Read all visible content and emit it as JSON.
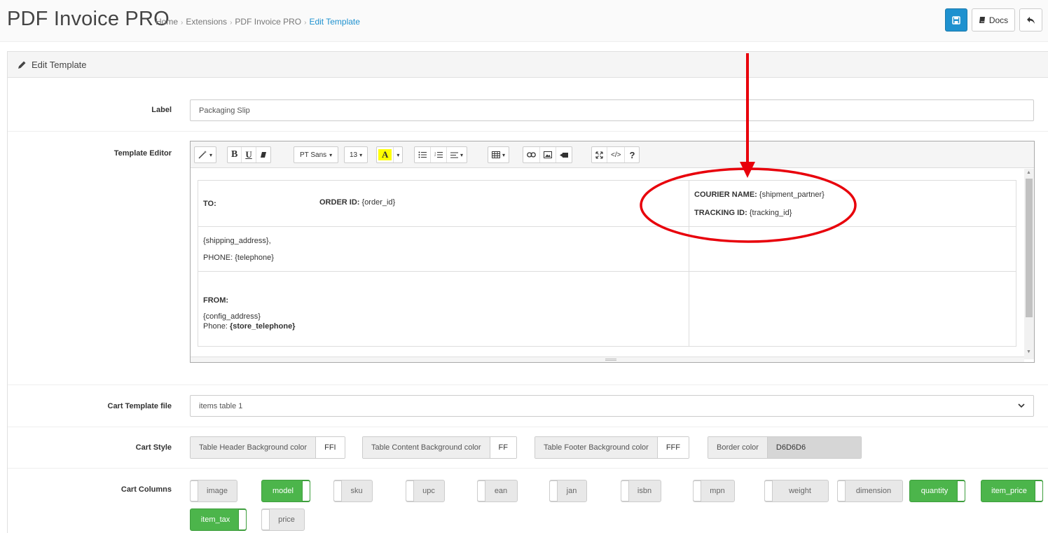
{
  "header": {
    "title": "PDF Invoice PRO",
    "breadcrumb": [
      "Home",
      "Extensions",
      "PDF Invoice PRO",
      "Edit Template"
    ],
    "docs_label": "Docs",
    "accent_color": "#1e91cf"
  },
  "panel": {
    "heading": "Edit Template"
  },
  "form": {
    "label": {
      "label": "Label",
      "value": "Packaging Slip"
    },
    "template_editor": {
      "label": "Template Editor",
      "toolbar": {
        "font_name": "PT Sans",
        "font_size": "13"
      },
      "content": {
        "to": "TO:",
        "order_id_label": "ORDER ID:",
        "order_id_value": "{order_id}",
        "courier_label": "COURIER NAME:",
        "courier_value": "{shipment_partner}",
        "tracking_label": "TRACKING ID:",
        "tracking_value": "{tracking_id}",
        "shipping_address": "{shipping_address},",
        "phone_label": "PHONE:",
        "phone_value": "{telephone}",
        "from": "FROM:",
        "config_address": "{config_address}",
        "store_phone_label": "Phone:",
        "store_phone_value": "{store_telephone}"
      }
    },
    "cart_template": {
      "label": "Cart Template file",
      "value": "items table 1"
    },
    "cart_style": {
      "label": "Cart Style",
      "items": [
        {
          "label": "Table Header Background color",
          "value": "FFI"
        },
        {
          "label": "Table Content Background color",
          "value": "FF"
        },
        {
          "label": "Table Footer Background color",
          "value": "FFF"
        },
        {
          "label": "Border color",
          "value": "D6D6D6"
        }
      ]
    },
    "cart_columns": {
      "label": "Cart Columns",
      "items": [
        {
          "label": "image",
          "on": false
        },
        {
          "label": "model",
          "on": true
        },
        {
          "label": "sku",
          "on": false
        },
        {
          "label": "upc",
          "on": false
        },
        {
          "label": "ean",
          "on": false
        },
        {
          "label": "jan",
          "on": false
        },
        {
          "label": "isbn",
          "on": false
        },
        {
          "label": "mpn",
          "on": false
        },
        {
          "label": "weight",
          "on": false
        },
        {
          "label": "dimension",
          "on": false
        },
        {
          "label": "quantity",
          "on": true
        },
        {
          "label": "item_price",
          "on": true
        },
        {
          "label": "item_tax",
          "on": true
        },
        {
          "label": "price",
          "on": false
        }
      ]
    }
  }
}
